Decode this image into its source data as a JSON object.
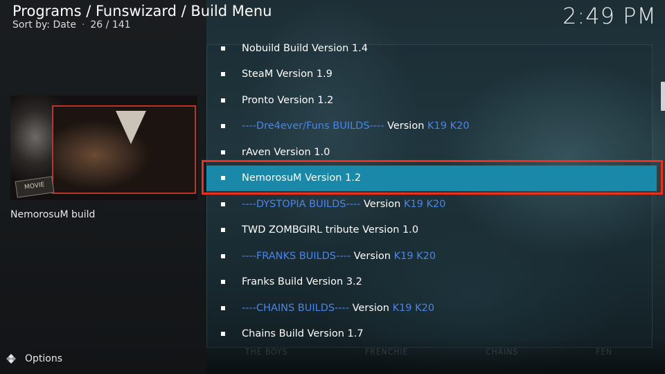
{
  "header": {
    "breadcrumb": "Programs / Funswizard / Build Menu",
    "sort_label": "Sort by: Date",
    "position": "26 / 141",
    "clock": "2:49 PM"
  },
  "preview": {
    "thumb_badge": "MOVIE",
    "description": "NemorosuM build"
  },
  "footer": {
    "options_label": "Options"
  },
  "background_labels": [
    "THE BOYS",
    "FRENCHIE",
    "CHAINS",
    "FEN"
  ],
  "colors": {
    "selection": "#1a88a8",
    "link_blue": "#4a86e8",
    "highlight_border": "#e8321e"
  },
  "list": {
    "items": [
      {
        "segments": [
          {
            "text": "Nobuild Build Version 1.4",
            "color": "white"
          }
        ]
      },
      {
        "segments": [
          {
            "text": "SteaM Version 1.9",
            "color": "white"
          }
        ]
      },
      {
        "segments": [
          {
            "text": "Pronto Version 1.2",
            "color": "white"
          }
        ]
      },
      {
        "segments": [
          {
            "text": "----Dre4ever/Funs BUILDS----",
            "color": "blue"
          },
          {
            "text": " Version ",
            "color": "white"
          },
          {
            "text": "K19 K20",
            "color": "blue"
          }
        ]
      },
      {
        "segments": [
          {
            "text": "rAven Version 1.0",
            "color": "white"
          }
        ]
      },
      {
        "selected": true,
        "segments": [
          {
            "text": "NemorosuM Version 1.2",
            "color": "white"
          }
        ]
      },
      {
        "segments": [
          {
            "text": "----DYSTOPIA BUILDS----",
            "color": "blue"
          },
          {
            "text": " Version ",
            "color": "white"
          },
          {
            "text": "K19 K20",
            "color": "blue"
          }
        ]
      },
      {
        "segments": [
          {
            "text": "TWD ZOMBGIRL tribute Version 1.0",
            "color": "white"
          }
        ]
      },
      {
        "segments": [
          {
            "text": "----FRANKS BUILDS----",
            "color": "blue"
          },
          {
            "text": " Version ",
            "color": "white"
          },
          {
            "text": "K19 K20",
            "color": "blue"
          }
        ]
      },
      {
        "segments": [
          {
            "text": "Franks Build Version 3.2",
            "color": "white"
          }
        ]
      },
      {
        "segments": [
          {
            "text": "----CHAINS BUILDS----",
            "color": "blue"
          },
          {
            "text": " Version ",
            "color": "white"
          },
          {
            "text": "K19 K20",
            "color": "blue"
          }
        ]
      },
      {
        "segments": [
          {
            "text": "Chains Build Version 1.7",
            "color": "white"
          }
        ]
      }
    ]
  }
}
